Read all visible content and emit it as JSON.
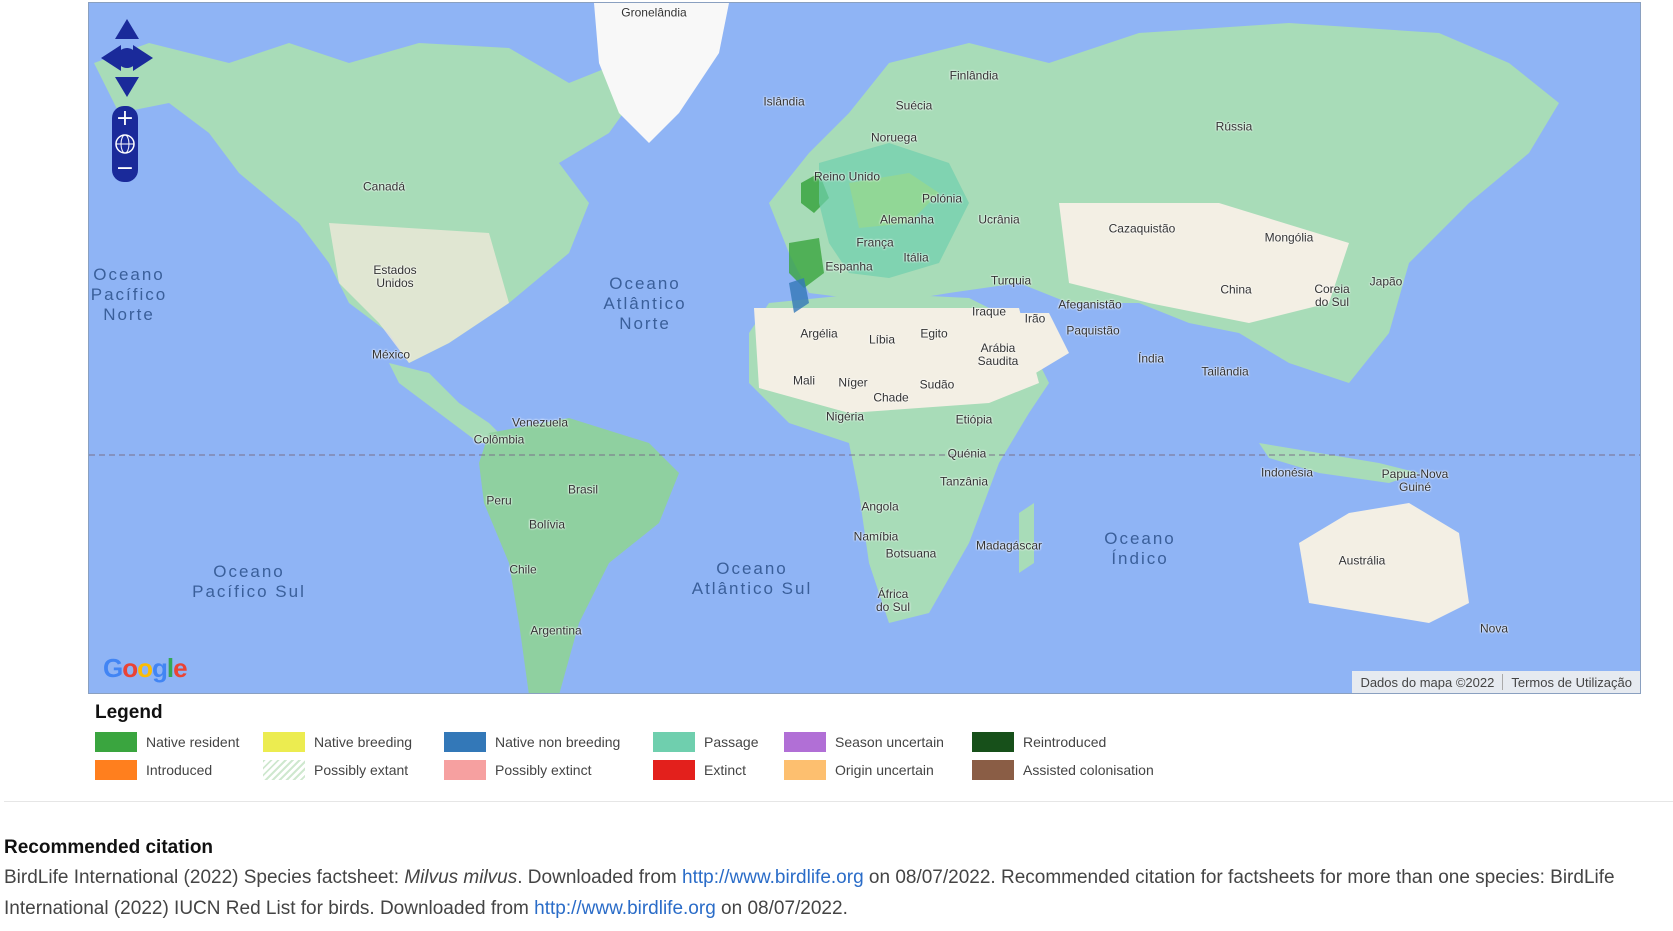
{
  "map": {
    "countries": {
      "gronelandia": "Gronelândia",
      "islandia": "Islândia",
      "finlandia": "Finlândia",
      "suecia": "Suécia",
      "noruega": "Noruega",
      "russia": "Rússia",
      "reino_unido": "Reino Unido",
      "polonia": "Polónia",
      "alemanha": "Alemanha",
      "ucrania": "Ucrânia",
      "franca": "França",
      "espanha": "Espanha",
      "italia": "Itália",
      "turquia": "Turquia",
      "cazaquistao": "Cazaquistão",
      "mongolia": "Mongólia",
      "canada": "Canadá",
      "estados_unidos": "Estados Unidos",
      "mexico": "México",
      "argelia": "Argélia",
      "libia": "Líbia",
      "egito": "Egito",
      "iraque": "Iraque",
      "irao": "Irão",
      "afeganistao": "Afeganistão",
      "paquistao": "Paquistão",
      "arabia_saudita": "Arábia Saudita",
      "china": "China",
      "coreia_do_sul": "Coreia do Sul",
      "japao": "Japão",
      "india": "Índia",
      "tailandia": "Tailândia",
      "mali": "Mali",
      "niger": "Níger",
      "chade": "Chade",
      "sudao": "Sudão",
      "nigeria": "Nigéria",
      "etiopia": "Etiópia",
      "quenia": "Quénia",
      "tanzania": "Tanzânia",
      "venezuela": "Venezuela",
      "colombia": "Colômbia",
      "brasil": "Brasil",
      "peru": "Peru",
      "bolivia": "Bolívia",
      "chile": "Chile",
      "argentina": "Argentina",
      "angola": "Angola",
      "namibia": "Namíbia",
      "botsuana": "Botsuana",
      "africa_do_sul": "África do Sul",
      "madagascar": "Madagáscar",
      "indonesia": "Indonésia",
      "papua_nova_guine": "Papua-Nova Guiné",
      "australia": "Austrália",
      "nova": "Nova"
    },
    "oceans": {
      "pacifico_norte": "Oceano Pacífico Norte",
      "atlantico_norte": "Oceano Atlântico Norte",
      "pacifico_sul": "Oceano Pacífico Sul",
      "atlantico_sul": "Oceano Atlântico Sul",
      "indico": "Oceano Índico"
    },
    "logo": "Google",
    "attribution": {
      "data": "Dados do mapa ©2022",
      "terms": "Termos de Utilização"
    },
    "colors": {
      "ocean": "#8fb4f5",
      "land_green": "#a8dcb8",
      "land_desert": "#f3efe4",
      "ice": "#f8f8f8",
      "control": "#1a2a9a"
    }
  },
  "legend": {
    "title": "Legend",
    "items": [
      {
        "label": "Native resident",
        "color": "#3aa53f"
      },
      {
        "label": "Native breeding",
        "color": "#ecec50"
      },
      {
        "label": "Native non breeding",
        "color": "#3378b8"
      },
      {
        "label": "Passage",
        "color": "#6fcfae"
      },
      {
        "label": "Season uncertain",
        "color": "#b16fd6"
      },
      {
        "label": "Reintroduced",
        "color": "#17501a"
      },
      {
        "label": "Introduced",
        "color": "#ff7f1e"
      },
      {
        "label": "Possibly extant",
        "color": "hatched"
      },
      {
        "label": "Possibly extinct",
        "color": "#f6a0a0"
      },
      {
        "label": "Extinct",
        "color": "#e3201c"
      },
      {
        "label": "Origin uncertain",
        "color": "#fdbf6f"
      },
      {
        "label": "Assisted colonisation",
        "color": "#8a5d45"
      }
    ]
  },
  "citation": {
    "title": "Recommended citation",
    "part1": "BirdLife International (2022) Species factsheet: ",
    "species": "Milvus milvus",
    "part2": ". Downloaded from ",
    "link1": "http://www.birdlife.org",
    "part3": " on 08/07/2022. Recommended citation for factsheets for more than one species: BirdLife International (2022) IUCN Red List for birds. Downloaded from ",
    "link2": "http://www.birdlife.org",
    "part4": " on 08/07/2022."
  }
}
